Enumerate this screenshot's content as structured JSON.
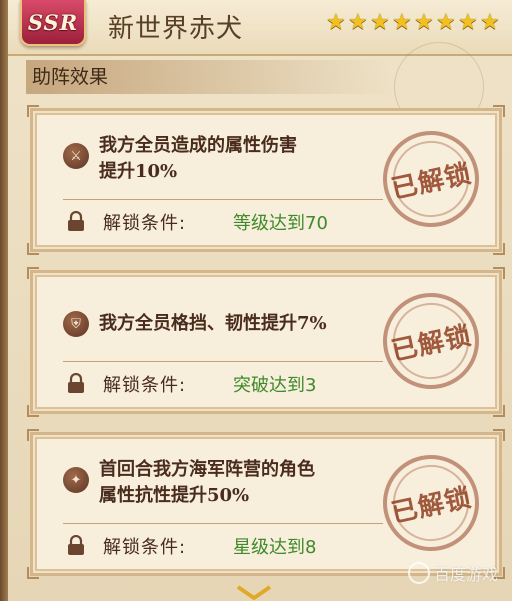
{
  "header": {
    "rarity": "SSR",
    "name": "新世界赤犬",
    "stars": 8
  },
  "section": {
    "title": "助阵效果"
  },
  "cards": [
    {
      "effect_line1": "我方全员造成的属性伤害",
      "effect_line2": "提升10%",
      "effect_icon": "sword-crest-icon",
      "lock_label": "解锁条件:",
      "lock_value": "等级达到70",
      "stamp": "已解锁"
    },
    {
      "effect_line1": "我方全员格挡、韧性提升7%",
      "effect_line2": "",
      "effect_icon": "shield-icon",
      "lock_label": "解锁条件:",
      "lock_value": "突破达到3",
      "stamp": "已解锁"
    },
    {
      "effect_line1": "首回合我方海军阵营的角色",
      "effect_line2": "属性抗性提升50%",
      "effect_icon": "emblem-icon",
      "lock_label": "解锁条件:",
      "lock_value": "星级达到8",
      "stamp": "已解锁"
    }
  ],
  "watermark": {
    "text": "百度游戏"
  },
  "colors": {
    "accent_red": "#9c1f3b",
    "unlock_green": "#3f8a2a",
    "star_gold": "#f1c21f"
  }
}
